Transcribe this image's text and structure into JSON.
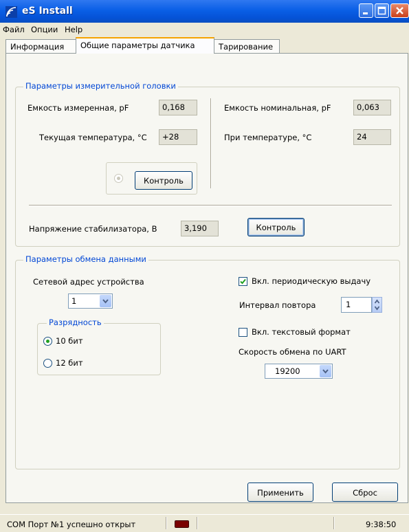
{
  "window": {
    "title": "eS Install",
    "app_icon": "signal-waves-icon"
  },
  "menu": [
    "Файл",
    "Опции",
    "Help"
  ],
  "tabs": [
    {
      "label": "Информация",
      "active": false
    },
    {
      "label": "Общие параметры датчика",
      "active": true
    },
    {
      "label": "Тарирование",
      "active": false
    }
  ],
  "head_group": {
    "title": "Параметры измерительной головки",
    "measured_capacity_label": "Емкость измеренная, pF",
    "measured_capacity_value": "0,168",
    "current_temp_label": "Текущая температура, °С",
    "current_temp_value": "+28",
    "nominal_capacity_label": "Емкость номинальная, pF",
    "nominal_capacity_value": "0,063",
    "at_temp_label": "При температуре, °С",
    "at_temp_value": "24",
    "control_button": "Контроль",
    "stabilizer_voltage_label": "Напряжение стабилизатора, В",
    "stabilizer_voltage_value": "3,190",
    "stabilizer_control_button": "Контроль"
  },
  "exchange_group": {
    "title": "Параметры обмена данными",
    "network_address_label": "Сетевой адрес устройства",
    "network_address_value": "1",
    "bitness_group_title": "Разрядность",
    "bit_options": [
      {
        "label": "10 бит",
        "selected": true
      },
      {
        "label": "12 бит",
        "selected": false
      }
    ],
    "periodic_output_label": "Вкл. периодическую выдачу",
    "periodic_output_checked": true,
    "repeat_interval_label": "Интервал повтора",
    "repeat_interval_value": "1",
    "text_format_label": "Вкл. текстовый формат",
    "text_format_checked": false,
    "uart_speed_label": "Скорость обмена по UART",
    "uart_speed_value": "19200"
  },
  "buttons": {
    "apply": "Применить",
    "reset": "Сброс"
  },
  "status": {
    "message": "COM Порт №1 успешно открыт",
    "time": "9:38:50"
  },
  "colors": {
    "accent_blue": "#0046d5",
    "title_bar": "#0a5fe6",
    "led_red": "#7a0000",
    "check_green": "#21a121"
  }
}
